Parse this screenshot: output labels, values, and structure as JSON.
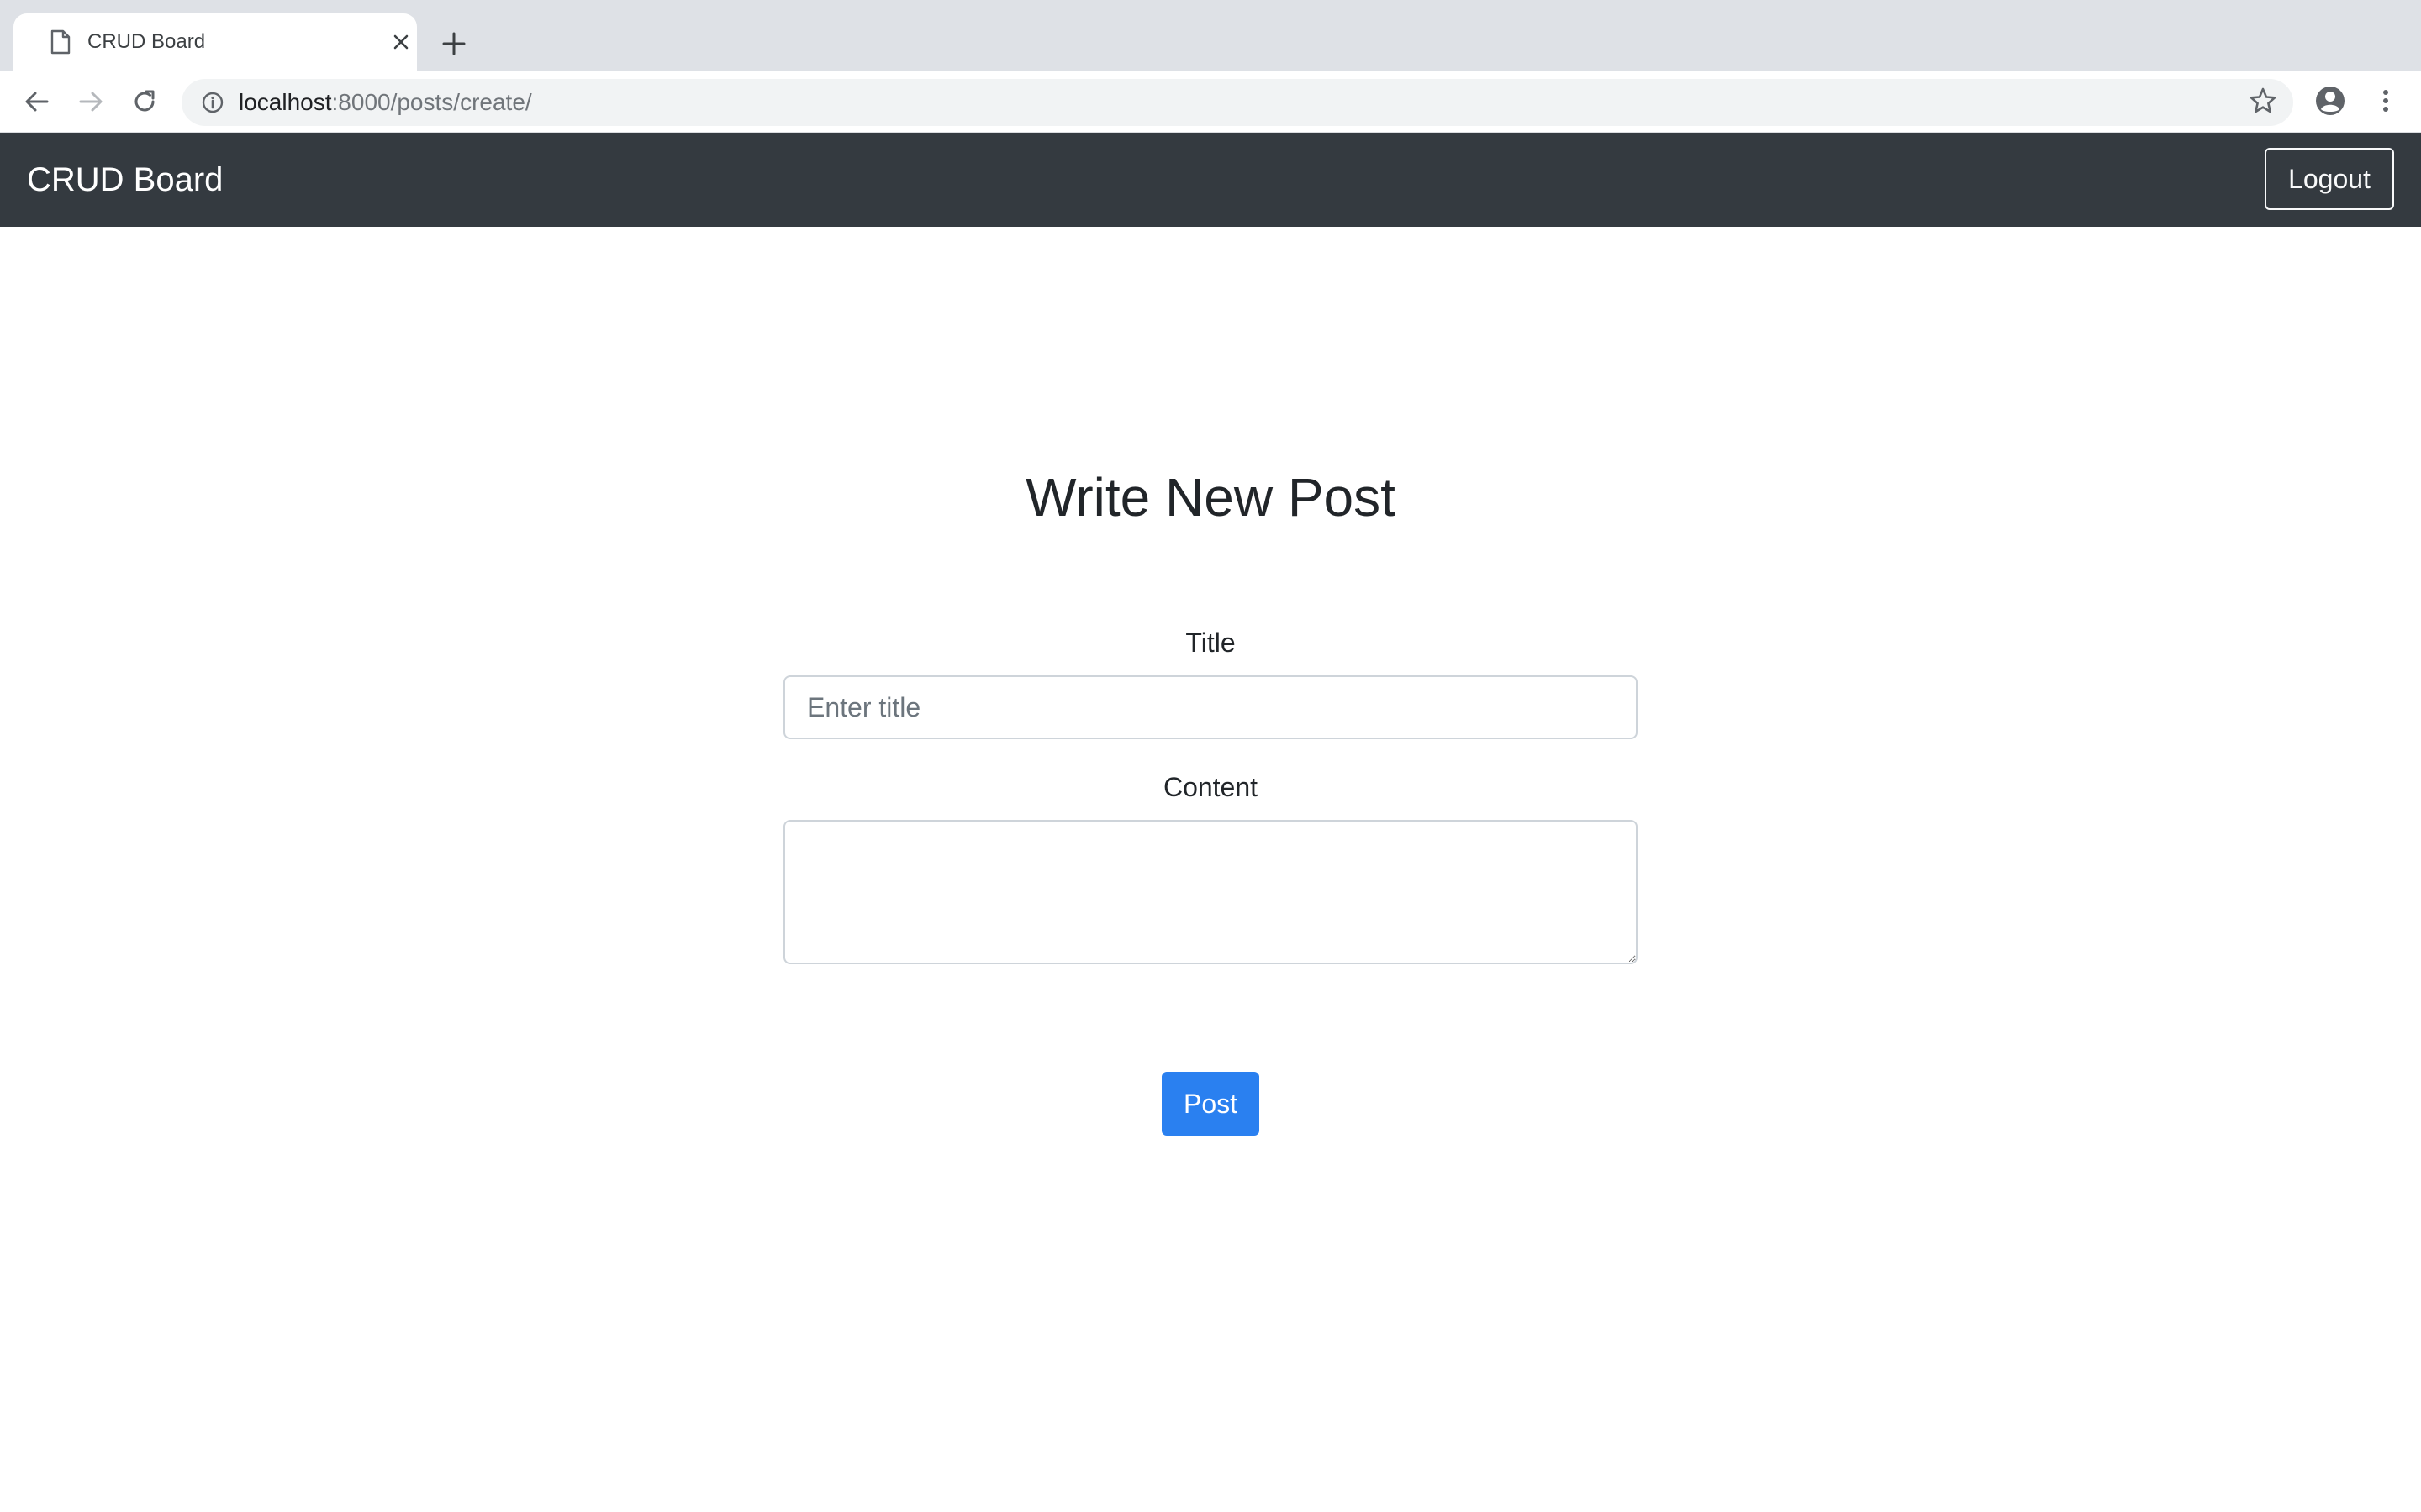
{
  "browser": {
    "tab_title": "CRUD Board",
    "url_host": "localhost",
    "url_path": ":8000/posts/create/",
    "icons": [
      "page-icon",
      "close-icon",
      "plus-icon",
      "back-arrow-icon",
      "forward-arrow-icon",
      "reload-icon",
      "info-icon",
      "star-icon",
      "profile-icon",
      "more-vertical-icon"
    ]
  },
  "navbar": {
    "brand": "CRUD Board",
    "logout_label": "Logout",
    "background_color": "#343a40"
  },
  "form": {
    "heading": "Write New Post",
    "title_label": "Title",
    "title_placeholder": "Enter title",
    "title_value": "",
    "content_label": "Content",
    "content_value": "",
    "submit_label": "Post",
    "submit_color": "#2a80f0"
  }
}
